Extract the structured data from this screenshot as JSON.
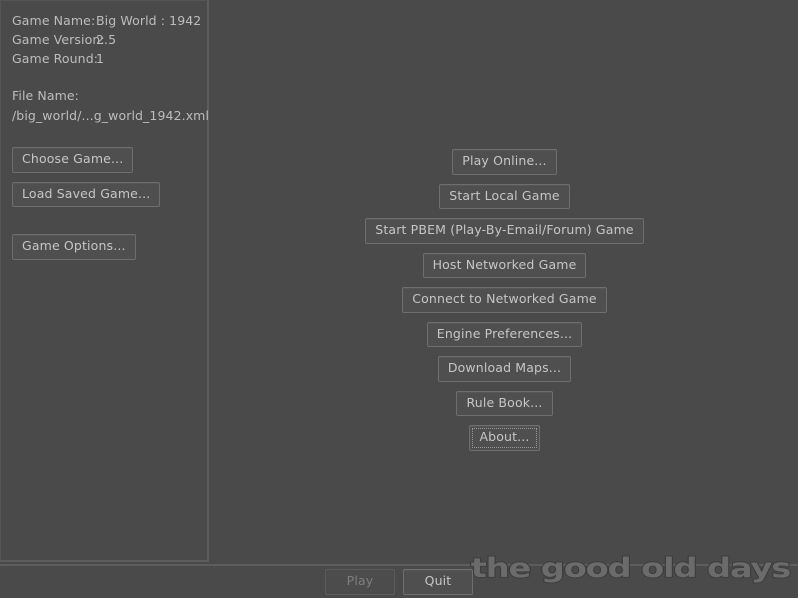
{
  "info_panel": {
    "rows": [
      {
        "label": "Game Name:",
        "value": "Big World : 1942"
      },
      {
        "label": "Game Version:",
        "value": "2.5"
      },
      {
        "label": "Game Round:",
        "value": "1"
      }
    ],
    "file_label": "File Name:",
    "file_value": "/big_world/...g_world_1942.xml"
  },
  "sidebar": {
    "buttons": [
      {
        "label": "Choose Game...",
        "enabled": true
      },
      {
        "label": "Load Saved Game...",
        "enabled": true
      }
    ],
    "options_button": {
      "label": "Game Options...",
      "enabled": true
    }
  },
  "menu": {
    "buttons": [
      {
        "label": "Play Online...",
        "enabled": true,
        "focused": false
      },
      {
        "label": "Start Local Game",
        "enabled": true,
        "focused": false
      },
      {
        "label": "Start PBEM (Play-By-Email/Forum) Game",
        "enabled": true,
        "focused": false
      },
      {
        "label": "Host Networked Game",
        "enabled": true,
        "focused": false
      },
      {
        "label": "Connect to Networked Game",
        "enabled": true,
        "focused": false
      },
      {
        "label": "Engine Preferences...",
        "enabled": true,
        "focused": false
      },
      {
        "label": "Download Maps...",
        "enabled": true,
        "focused": false
      },
      {
        "label": "Rule Book...",
        "enabled": true,
        "focused": false
      },
      {
        "label": "About...",
        "enabled": true,
        "focused": true
      }
    ]
  },
  "bottom_bar": {
    "play_label": "Play",
    "play_enabled": false,
    "quit_label": "Quit",
    "quit_enabled": true
  },
  "watermark": {
    "text": "the good old days"
  },
  "colors": {
    "background": "#4a4a4a",
    "panel_border": "#5d5d5d",
    "button_face": "#4f4f4f",
    "button_border": "#6e6e6e",
    "text": "#bdbdbd",
    "button_text": "#c6c6c6",
    "disabled_text": "#7e7e7e",
    "watermark_fill": "#6b6b6b",
    "watermark_stroke": "#3d3d3d"
  }
}
